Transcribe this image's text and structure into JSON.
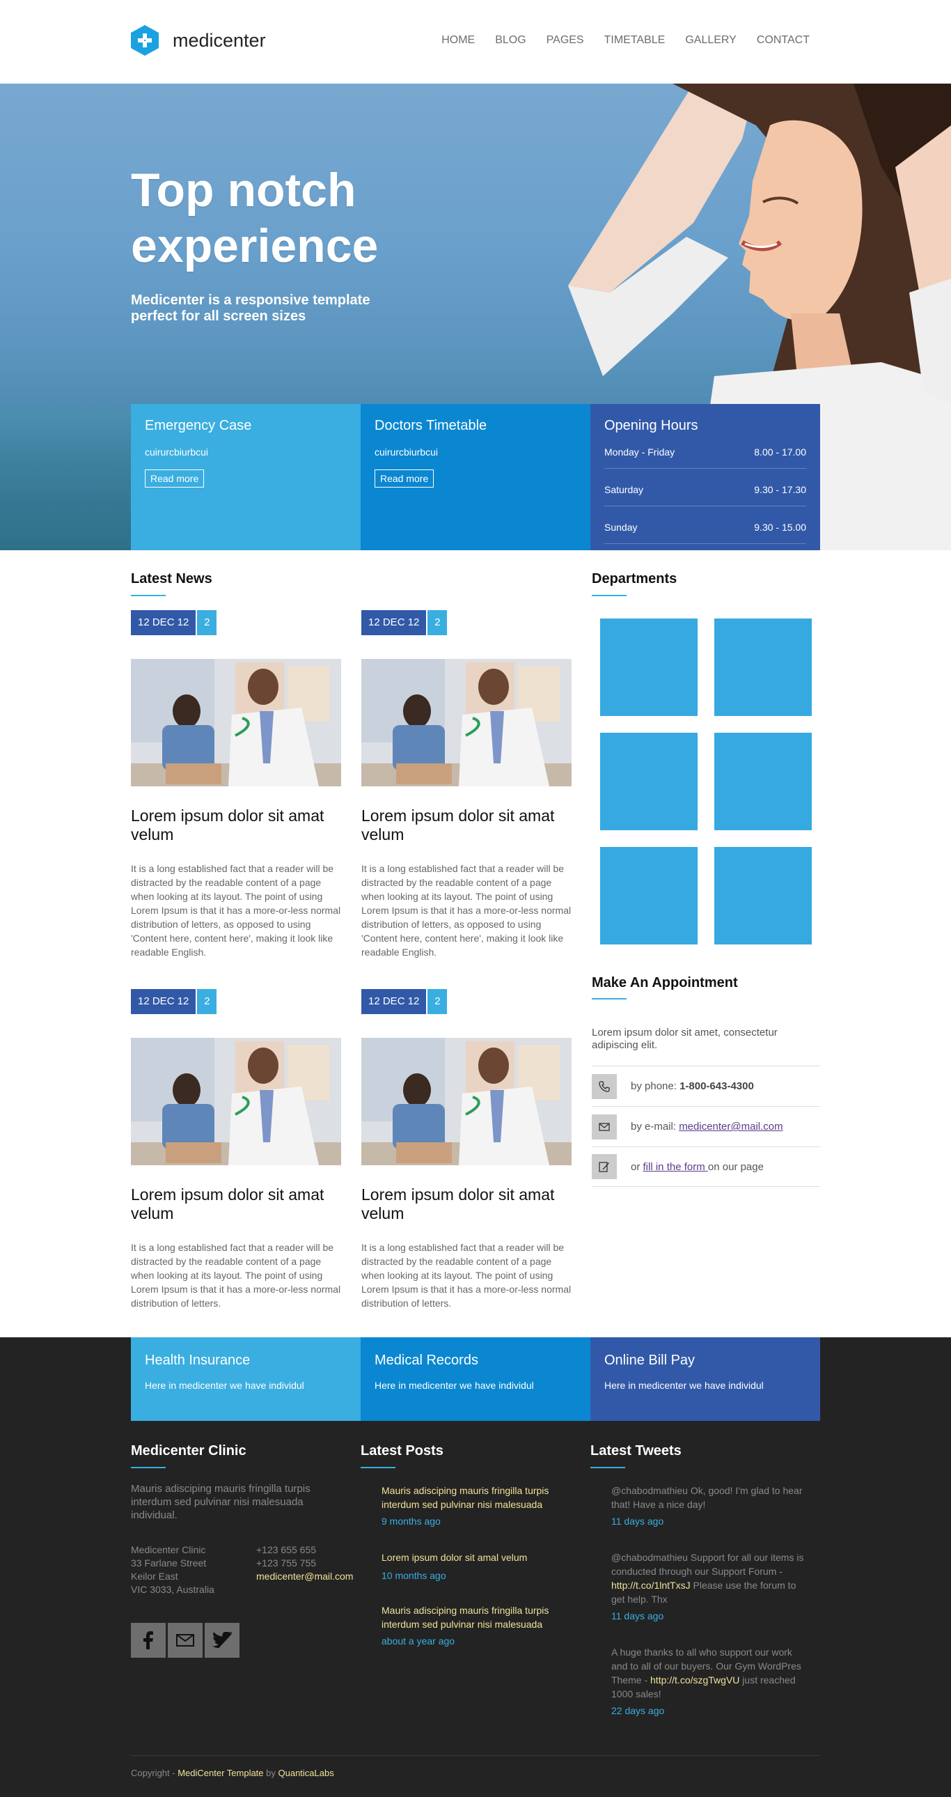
{
  "header": {
    "logo_text": "medicenter",
    "nav": [
      "HOME",
      "BLOG",
      "PAGES",
      "TIMETABLE",
      "GALLERY",
      "CONTACT"
    ]
  },
  "hero": {
    "title": "Top notch experience",
    "subtitle": "Medicenter is a responsive template perfect for all screen sizes"
  },
  "info_boxes": {
    "emergency": {
      "title": "Emergency Case",
      "text": "cuirurcbiurbcui",
      "button": "Read more"
    },
    "timetable": {
      "title": "Doctors Timetable",
      "text": "cuirurcbiurbcui",
      "button": "Read more"
    },
    "hours": {
      "title": "Opening Hours",
      "rows": [
        {
          "day": "Monday - Friday",
          "time": "8.00 - 17.00"
        },
        {
          "day": "Saturday",
          "time": "9.30 - 17.30"
        },
        {
          "day": "Sunday",
          "time": "9.30 - 15.00"
        }
      ]
    }
  },
  "latest_news": {
    "heading": "Latest News",
    "items": [
      {
        "date": "12 DEC 12",
        "comments": "2",
        "title": "Lorem ipsum dolor sit amat velum",
        "text": "It is a long established fact that a reader will be distracted by the readable content of a page when looking at its layout. The point of using Lorem Ipsum is that it has a more-or-less normal distribution of letters, as opposed to using 'Content here, content here', making it look like readable English."
      },
      {
        "date": "12 DEC 12",
        "comments": "2",
        "title": "Lorem ipsum dolor sit amat velum",
        "text": "It is a long established fact that a reader will be distracted by the readable content of a page when looking at its layout. The point of using Lorem Ipsum is that it has a more-or-less normal distribution of letters, as opposed to using 'Content here, content here', making it look like readable English."
      },
      {
        "date": "12 DEC 12",
        "comments": "2",
        "title": "Lorem ipsum dolor sit amat velum",
        "text": "It is a long established fact that a reader will be distracted by the readable content of a page when looking at its layout. The point of using Lorem Ipsum is that it has a more-or-less normal distribution of letters."
      },
      {
        "date": "12 DEC 12",
        "comments": "2",
        "title": "Lorem ipsum dolor sit amat velum",
        "text": "It is a long established fact that a reader will be distracted by the readable content of a page when looking at its layout. The point of using Lorem Ipsum is that it has a more-or-less normal distribution of letters."
      }
    ]
  },
  "departments": {
    "heading": "Departments"
  },
  "appointment": {
    "heading": "Make An Appointment",
    "intro": "Lorem ipsum dolor sit amet, consectetur adipiscing elit.",
    "phone_label": "by phone: ",
    "phone": "1-800-643-4300",
    "email_label": "by e-mail: ",
    "email": "medicenter@mail.com",
    "form_prefix": "or ",
    "form_link": "fill in the form ",
    "form_suffix": "on our page"
  },
  "footer_boxes": [
    {
      "title": "Health Insurance",
      "text": "Here in medicenter we have individul"
    },
    {
      "title": "Medical Records",
      "text": "Here in medicenter we have individul"
    },
    {
      "title": "Online Bill Pay",
      "text": "Here in medicenter we have individul"
    }
  ],
  "clinic": {
    "heading": "Medicenter Clinic",
    "intro": "Mauris adisciping mauris fringilla turpis interdum sed pulvinar nisi malesuada individual.",
    "address": [
      "Medicenter Clinic",
      "33 Farlane Street",
      "Keilor East",
      "VIC 3033, Australia"
    ],
    "phones": [
      "+123 655 655",
      "+123 755 755"
    ],
    "email": "medicenter@mail.com"
  },
  "latest_posts": {
    "heading": "Latest Posts",
    "items": [
      {
        "title": "Mauris adisciping mauris fringilla turpis interdum sed pulvinar nisi malesuada",
        "time": "9 months ago"
      },
      {
        "title": "Lorem ipsum dolor sit amal velum",
        "time": "10 months ago"
      },
      {
        "title": "Mauris adisciping mauris fringilla turpis interdum sed pulvinar nisi malesuada",
        "time": "about a year ago"
      }
    ]
  },
  "latest_tweets": {
    "heading": "Latest Tweets",
    "items": [
      {
        "text": "@chabodmathieu Ok, good! I'm glad to hear that! Have a nice day!",
        "link": "",
        "after": "",
        "time": "11 days ago"
      },
      {
        "text": "@chabodmathieu Support for all our items is conducted through our Support Forum - ",
        "link": "http://t.co/1lntTxsJ",
        "after": " Please use the forum to get help. Thx",
        "time": "11 days ago"
      },
      {
        "text": "A huge thanks to all who support our work and to all of our buyers. Our Gym WordPres Theme - ",
        "link": "http://t.co/szgTwgVU",
        "after": " just reached 1000 sales!",
        "time": "22 days ago"
      }
    ]
  },
  "copyright": {
    "prefix": "Copyright - ",
    "template": "MediCenter Template",
    "by": " by ",
    "author": "QuanticaLabs"
  }
}
